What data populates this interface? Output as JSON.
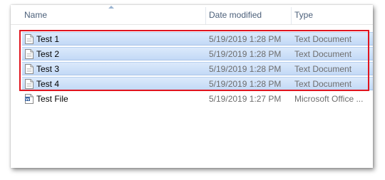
{
  "columns": {
    "name": "Name",
    "date_modified": "Date modified",
    "type": "Type"
  },
  "files": [
    {
      "name": "Test 1",
      "date": "5/19/2019 1:28 PM",
      "type": "Text Document",
      "icon": "text-document-icon",
      "selected": true
    },
    {
      "name": "Test 2",
      "date": "5/19/2019 1:28 PM",
      "type": "Text Document",
      "icon": "text-document-icon",
      "selected": true
    },
    {
      "name": "Test 3",
      "date": "5/19/2019 1:28 PM",
      "type": "Text Document",
      "icon": "text-document-icon",
      "selected": true
    },
    {
      "name": "Test 4",
      "date": "5/19/2019 1:28 PM",
      "type": "Text Document",
      "icon": "text-document-icon",
      "selected": true
    },
    {
      "name": "Test File",
      "date": "5/19/2019 1:27 PM",
      "type": "Microsoft Office ...",
      "icon": "word-document-icon",
      "selected": false
    }
  ],
  "colors": {
    "selection": "#cfe2f9",
    "highlight_border": "#e0141e",
    "header_text": "#4c607a"
  }
}
